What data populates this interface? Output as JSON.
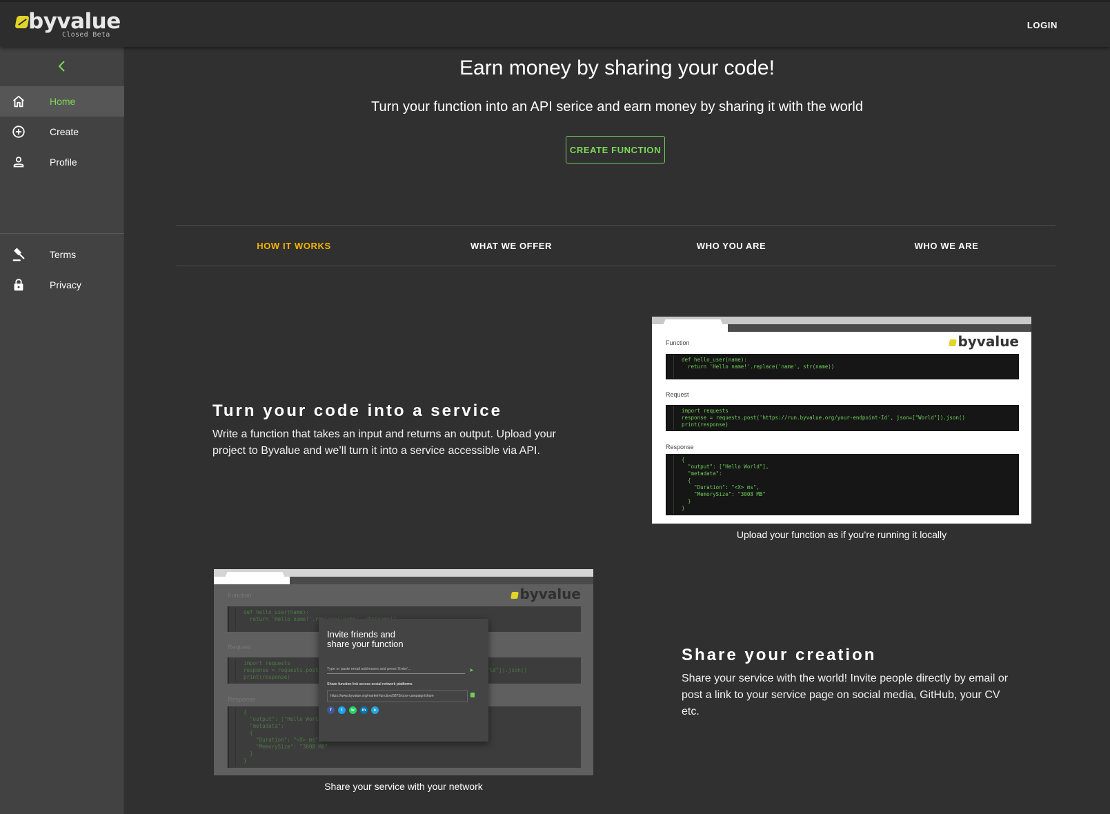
{
  "header": {
    "logo_text": "byvalue",
    "logo_subtitle": "Closed Beta",
    "login_label": "LOGIN"
  },
  "sidebar": {
    "collapse_icon": "chevron-left-icon",
    "items": [
      {
        "label": "Home",
        "icon": "home-icon",
        "active": true
      },
      {
        "label": "Create",
        "icon": "add-circle-icon",
        "active": false
      },
      {
        "label": "Profile",
        "icon": "person-icon",
        "active": false
      },
      {
        "label": "Terms",
        "icon": "gavel-icon",
        "active": false
      },
      {
        "label": "Privacy",
        "icon": "lock-icon",
        "active": false
      }
    ]
  },
  "hero": {
    "title": "Earn money by sharing your code!",
    "subtitle": "Turn your function into an API serice and earn money by sharing it with the world",
    "cta_label": "CREATE FUNCTION"
  },
  "tabs": [
    {
      "label": "HOW IT WORKS",
      "active": true
    },
    {
      "label": "WHAT WE OFFER",
      "active": false
    },
    {
      "label": "WHO YOU ARE",
      "active": false
    },
    {
      "label": "WHO WE ARE",
      "active": false
    }
  ],
  "sections": [
    {
      "title": "Turn your code into a service",
      "body": "Write a function that takes an input and returns an output. Upload your project to Byvalue and we’ll turn it into a service accessible via API.",
      "caption": "Upload your function as if you’re running it locally"
    },
    {
      "title": "Share your creation",
      "body": "Share your service with the world! Invite people directly by email or post a link to your service page on social media, GitHub, your CV etc.",
      "caption": "Share your service with your network"
    }
  ],
  "mock_upload": {
    "logo": "byvalue",
    "function_label": "Function",
    "function_code": "def hello_user(name):\n  return 'Hello name!'.replace('name', str(name))",
    "request_label": "Request",
    "request_code": "import requests\nresponse = requests.post('https://run.byvalue.org/your-endpoint-Id', json=[\"World\"]).json()\nprint(response)",
    "response_label": "Response",
    "response_code": "{\n  \"output\": [\"Hello World\"],\n  \"metadata\":\n  {\n    \"Duration\": \"<X> ms\",\n    \"MemorySize\": \"3008 MB\"\n  }\n}"
  },
  "mock_share": {
    "logo": "byvalue",
    "function_label": "Function",
    "function_code": "def hello_user(name):\n  return 'Hello name!'.replace('name', str(name))",
    "request_label": "Request",
    "request_code": "import requests\nresponse = requests.post('https://run.byvalue.org/your-endpoint-Id', json=[\"World\"]).json()\nprint(response)",
    "response_label": "Response",
    "response_code": "{\n  \"output\": [\"Hello World\"],\n  \"metadata\":\n  {\n    \"Duration\": \"<X> ms\",\n    \"MemorySize\": \"3008 MB\"\n  }\n}",
    "dialog_title": "Invite friends and\nshare your function",
    "email_placeholder": "Type or paste email addresses and press 'Enter'...",
    "share_label": "Share function link across social network platforms",
    "share_link": "https://www.byvalue.org/market-function/3873/xxxx-campaign/share",
    "social": [
      {
        "icon": "facebook-icon",
        "letter": "f",
        "color": "#3b5998"
      },
      {
        "icon": "twitter-icon",
        "letter": "t",
        "color": "#1da1f2"
      },
      {
        "icon": "whatsapp-icon",
        "letter": "w",
        "color": "#25d366"
      },
      {
        "icon": "linkedin-icon",
        "letter": "in",
        "color": "#0077b5"
      },
      {
        "icon": "telegram-icon",
        "letter": "➤",
        "color": "#2aa3df"
      }
    ]
  },
  "colors": {
    "accent_green": "#7ed957",
    "tab_active": "#f4b400",
    "logo_yellow": "#e1d42a"
  }
}
